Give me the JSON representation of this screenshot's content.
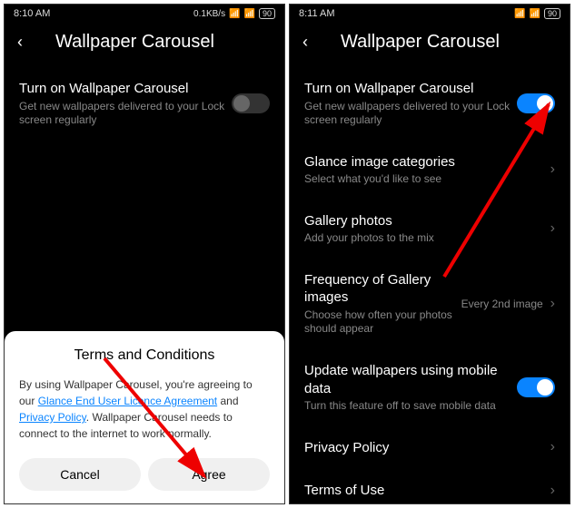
{
  "left": {
    "status": {
      "time": "8:10 AM",
      "net": "0.1KB/s",
      "battery": "90"
    },
    "title": "Wallpaper Carousel",
    "turn_on": {
      "title": "Turn on Wallpaper Carousel",
      "sub": "Get new wallpapers delivered to your Lock screen regularly"
    },
    "terms": {
      "title": "Terms and Conditions",
      "body_1": "By using Wallpaper Carousel, you're agreeing to our ",
      "link1": "Glance End User Licence Agreement",
      "body_2": " and ",
      "link2": "Privacy Policy",
      "body_3": ". Wallpaper Carousel needs to connect to the internet to work normally.",
      "cancel": "Cancel",
      "agree": "Agree"
    }
  },
  "right": {
    "status": {
      "time": "8:11 AM",
      "battery": "90"
    },
    "title": "Wallpaper Carousel",
    "items": {
      "turn_on": {
        "title": "Turn on Wallpaper Carousel",
        "sub": "Get new wallpapers delivered to your Lock screen regularly"
      },
      "glance": {
        "title": "Glance image categories",
        "sub": "Select what you'd like to see"
      },
      "gallery": {
        "title": "Gallery photos",
        "sub": "Add your photos to the mix"
      },
      "freq": {
        "title": "Frequency of Gallery images",
        "sub": "Choose how often your photos should appear",
        "value": "Every 2nd image"
      },
      "mobile": {
        "title": "Update wallpapers using mobile data",
        "sub": "Turn this feature off to save mobile data"
      },
      "privacy": {
        "title": "Privacy Policy"
      },
      "tou": {
        "title": "Terms of Use"
      }
    }
  }
}
